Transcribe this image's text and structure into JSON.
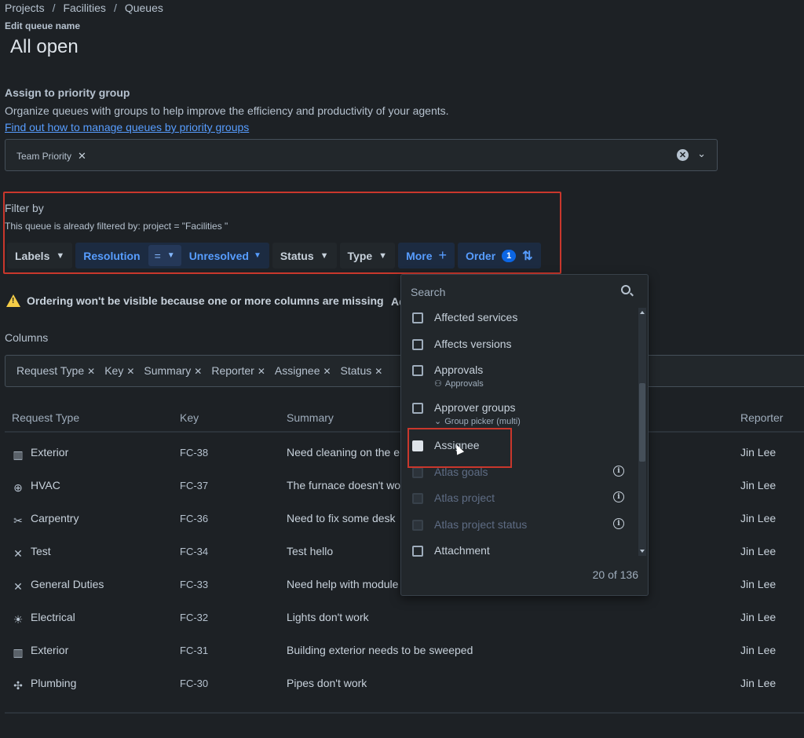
{
  "breadcrumb": [
    "Projects",
    "Facilities",
    "Queues"
  ],
  "edit_label": "Edit queue name",
  "page_title": "All open",
  "priority": {
    "heading": "Assign to priority group",
    "description": "Organize queues with groups to help improve the efficiency and productivity of your agents.",
    "link": "Find out how to manage queues by priority groups",
    "selected_chip": "Team Priority"
  },
  "filter": {
    "title": "Filter by",
    "note": "This queue is already filtered by:  project = \"Facilities \"",
    "labels_btn": "Labels",
    "resolution_field": "Resolution",
    "resolution_op": "=",
    "resolution_value": "Unresolved",
    "status_btn": "Status",
    "type_btn": "Type",
    "more_btn": "More",
    "order_btn": "Order",
    "order_count": "1"
  },
  "warning": {
    "text": "Ordering won't be visible because one or more columns are missing",
    "tail": "Ad"
  },
  "columns": {
    "label": "Columns",
    "chips": [
      "Request Type",
      "Key",
      "Summary",
      "Reporter",
      "Assignee",
      "Status"
    ]
  },
  "table": {
    "headers": {
      "request_type": "Request Type",
      "key": "Key",
      "summary": "Summary",
      "reporter": "Reporter"
    },
    "rows": [
      {
        "icon": "building-icon",
        "type": "Exterior",
        "key": "FC-38",
        "summary": "Need cleaning on the e",
        "reporter": "Jin Lee"
      },
      {
        "icon": "lifebuoy-icon",
        "type": "HVAC",
        "key": "FC-37",
        "summary": "The furnace doesn't wo",
        "reporter": "Jin Lee"
      },
      {
        "icon": "tools-icon",
        "type": "Carpentry",
        "key": "FC-36",
        "summary": "Need to fix some desk",
        "reporter": "Jin Lee"
      },
      {
        "icon": "wrench-icon",
        "type": "Test",
        "key": "FC-34",
        "summary": "Test hello",
        "reporter": "Jin Lee"
      },
      {
        "icon": "wrench-icon",
        "type": "General Duties",
        "key": "FC-33",
        "summary": "Need help with module",
        "reporter": "Jin Lee"
      },
      {
        "icon": "lightbulb-icon",
        "type": "Electrical",
        "key": "FC-32",
        "summary": "Lights don't work",
        "reporter": "Jin Lee"
      },
      {
        "icon": "building-icon",
        "type": "Exterior",
        "key": "FC-31",
        "summary": "Building exterior needs to be sweeped",
        "reporter": "Jin Lee"
      },
      {
        "icon": "pipe-icon",
        "type": "Plumbing",
        "key": "FC-30",
        "summary": "Pipes don't work",
        "reporter": "Jin Lee"
      }
    ]
  },
  "dropdown": {
    "search_placeholder": "Search",
    "items": [
      {
        "label": "Affected services",
        "sub": "",
        "state": "normal",
        "info": false
      },
      {
        "label": "Affects versions",
        "sub": "",
        "state": "normal",
        "info": false
      },
      {
        "label": "Approvals",
        "sub": "Approvals",
        "state": "normal",
        "info": false
      },
      {
        "label": "Approver groups",
        "sub": "Group picker (multi)",
        "state": "normal",
        "info": false
      },
      {
        "label": "Assignee",
        "sub": "",
        "state": "hover",
        "info": false
      },
      {
        "label": "Atlas goals",
        "sub": "",
        "state": "disabled",
        "info": true
      },
      {
        "label": "Atlas project",
        "sub": "",
        "state": "disabled",
        "info": true
      },
      {
        "label": "Atlas project status",
        "sub": "",
        "state": "disabled",
        "info": true
      },
      {
        "label": "Attachment",
        "sub": "",
        "state": "normal",
        "info": false
      }
    ],
    "count": "20 of 136"
  }
}
